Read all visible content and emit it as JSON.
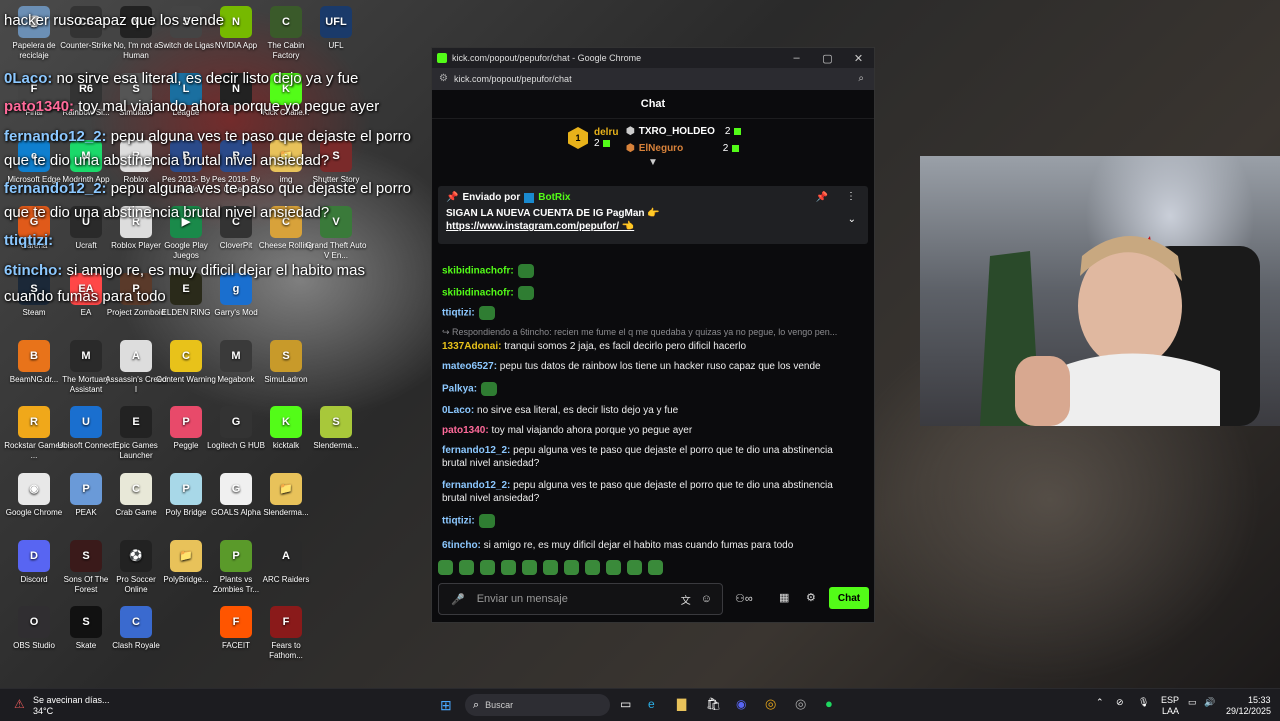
{
  "desktop": {
    "icons": [
      {
        "label": "Papelera de reciclaje",
        "color": "#6b8fb5",
        "glyph": "🗑"
      },
      {
        "label": "Counter-Strike",
        "color": "#333",
        "glyph": "CS"
      },
      {
        "label": "No, I'm not a Human",
        "color": "#222",
        "glyph": "N"
      },
      {
        "label": "Switch de Ligas",
        "color": "#444",
        "glyph": "S"
      },
      {
        "label": "NVIDIA App",
        "color": "#76b900",
        "glyph": "N"
      },
      {
        "label": "The Cabin Factory",
        "color": "#3a5a2a",
        "glyph": "C"
      },
      {
        "label": "UFL",
        "color": "#1a3a6a",
        "glyph": "UFL"
      },
      {
        "label": "Final",
        "color": "#444",
        "glyph": "F"
      },
      {
        "label": "Rainbow Si...",
        "color": "#333",
        "glyph": "R6"
      },
      {
        "label": "Simulator",
        "color": "#555",
        "glyph": "S"
      },
      {
        "label": "League",
        "color": "#1a6fa0",
        "glyph": "L"
      },
      {
        "label": "",
        "color": "#222",
        "glyph": "N"
      },
      {
        "label": "Kick Challe...",
        "color": "#53fc18",
        "glyph": "K"
      },
      {
        "label": "Microsoft Edge",
        "color": "#0f7fcf",
        "glyph": "e"
      },
      {
        "label": "Modrinth App",
        "color": "#1bd96a",
        "glyph": "M"
      },
      {
        "label": "Roblox",
        "color": "#ddd",
        "glyph": "R"
      },
      {
        "label": "Pes 2013- By Cimelo",
        "color": "#2a4a8a",
        "glyph": "P"
      },
      {
        "label": "Pes 2018- By Cimelo",
        "color": "#2a4a8a",
        "glyph": "P"
      },
      {
        "label": "img",
        "color": "#e8c25a",
        "glyph": "📁"
      },
      {
        "label": "Shutter Story",
        "color": "#7a2a2a",
        "glyph": "S"
      },
      {
        "label": "Garena",
        "color": "#e05a1a",
        "glyph": "G"
      },
      {
        "label": "Ucraft",
        "color": "#2a2a2a",
        "glyph": "U"
      },
      {
        "label": "Roblox Player",
        "color": "#ddd",
        "glyph": "R"
      },
      {
        "label": "Google Play Juegos",
        "color": "#1a8a4a",
        "glyph": "▶"
      },
      {
        "label": "CloverPit",
        "color": "#333",
        "glyph": "C"
      },
      {
        "label": "Cheese Rolling",
        "color": "#d8a23a",
        "glyph": "C"
      },
      {
        "label": "Grand Theft Auto V En...",
        "color": "#3a7a3a",
        "glyph": "V"
      },
      {
        "label": "Steam",
        "color": "#1b2838",
        "glyph": "S"
      },
      {
        "label": "EA",
        "color": "#ff4747",
        "glyph": "EA"
      },
      {
        "label": "Project Zomboid",
        "color": "#5a3a2a",
        "glyph": "P"
      },
      {
        "label": "ELDEN RING",
        "color": "#2a2a1a",
        "glyph": "E"
      },
      {
        "label": "Garry's Mod",
        "color": "#1a6fcf",
        "glyph": "g"
      },
      {
        "label": "BeamNG.dr...",
        "color": "#e8731a",
        "glyph": "B"
      },
      {
        "label": "The Mortuary Assistant",
        "color": "#2a2a2a",
        "glyph": "M"
      },
      {
        "label": "Assassin's Creed I",
        "color": "#ddd",
        "glyph": "A"
      },
      {
        "label": "Content Warning",
        "color": "#e8c21a",
        "glyph": "C"
      },
      {
        "label": "Megabonk",
        "color": "#3a3a3a",
        "glyph": "M"
      },
      {
        "label": "SimuLadron",
        "color": "#c89a2a",
        "glyph": "S"
      },
      {
        "label": "Rockstar Games ...",
        "color": "#f0a81a",
        "glyph": "R"
      },
      {
        "label": "Ubisoft Connect",
        "color": "#1a6fcf",
        "glyph": "U"
      },
      {
        "label": "Epic Games Launcher",
        "color": "#222",
        "glyph": "E"
      },
      {
        "label": "Peggle",
        "color": "#e84a6a",
        "glyph": "P"
      },
      {
        "label": "Logitech G HUB",
        "color": "#333",
        "glyph": "G"
      },
      {
        "label": "kicktalk",
        "color": "#53fc18",
        "glyph": "K"
      },
      {
        "label": "Slenderma...",
        "color": "#a8c83a",
        "glyph": "S"
      },
      {
        "label": "Google Chrome",
        "color": "#e8e8e8",
        "glyph": "◉"
      },
      {
        "label": "PEAK",
        "color": "#6a9ad8",
        "glyph": "P"
      },
      {
        "label": "Crab Game",
        "color": "#e8e8d8",
        "glyph": "C"
      },
      {
        "label": "Poly Bridge",
        "color": "#a8d8e8",
        "glyph": "P"
      },
      {
        "label": "GOALS Alpha",
        "color": "#f0f0f0",
        "glyph": "G"
      },
      {
        "label": "Slenderma...",
        "color": "#e8c25a",
        "glyph": "📁"
      },
      {
        "label": "Discord",
        "color": "#5865f2",
        "glyph": "D"
      },
      {
        "label": "Sons Of The Forest",
        "color": "#3a1a1a",
        "glyph": "S"
      },
      {
        "label": "Pro Soccer Online",
        "color": "#222",
        "glyph": "⚽"
      },
      {
        "label": "PolyBridge...",
        "color": "#e8c25a",
        "glyph": "📁"
      },
      {
        "label": "Plants vs Zombies Tr...",
        "color": "#5a9a2a",
        "glyph": "P"
      },
      {
        "label": "ARC Raiders",
        "color": "#2a2a2a",
        "glyph": "A"
      },
      {
        "label": "OBS Studio",
        "color": "#302e31",
        "glyph": "O"
      },
      {
        "label": "Skate",
        "color": "#111",
        "glyph": "S"
      },
      {
        "label": "Clash Royale",
        "color": "#3a6acf",
        "glyph": "C"
      },
      {
        "label": "FACEIT",
        "color": "#ff5500",
        "glyph": "F"
      },
      {
        "label": "Fears to Fathom...",
        "color": "#8a1a1a",
        "glyph": "F"
      }
    ]
  },
  "overlay_chat": [
    {
      "user": "",
      "text": "hacker ruso capaz que los vende",
      "color": "#ffffff"
    },
    {
      "user": "0Laco:",
      "text": " no sirve esa literal, es decir listo dejo ya y fue",
      "color": "#8cc8ff"
    },
    {
      "user": "pato1340:",
      "text": " toy mal viajando ahora porque yo pegue ayer",
      "color": "#ff6a9a"
    },
    {
      "user": "fernando12_2:",
      "text": " pepu alguna ves te paso que dejaste el porro",
      "color": "#8cc8ff"
    },
    {
      "user": "",
      "text": "que te dio una abstinencia brutal nivel ansiedad?",
      "color": "#ffffff"
    },
    {
      "user": "fernando12_2:",
      "text": " pepu alguna ves te paso que dejaste el porro",
      "color": "#8cc8ff"
    },
    {
      "user": "",
      "text": "que te dio una abstinencia brutal nivel ansiedad?",
      "color": "#ffffff"
    },
    {
      "user": "ttiqtizi:",
      "text": "",
      "color": "#8cc8ff"
    },
    {
      "user": "6tincho:",
      "text": " si amigo      re, es muy dificil dejar el habito mas",
      "color": "#8cc8ff"
    },
    {
      "user": "",
      "text": "cuando fumas para todo",
      "color": "#ffffff"
    }
  ],
  "window": {
    "title": "kick.com/popout/pepufor/chat - Google Chrome",
    "url": "kick.com/popout/pepufor/chat",
    "chat_header": "Chat",
    "leaderboard": {
      "first": {
        "name": "delru",
        "count": "2"
      },
      "second": {
        "name": "TXRO_HOLDEO",
        "count": "2"
      },
      "third": {
        "name": "ElNeguro",
        "count": "2"
      }
    },
    "pinned": {
      "prefix": "Enviado por",
      "sender": "BotRix",
      "line1": "SIGAN LA NUEVA CUENTA DE IG PagMan 👉",
      "line2": "https://www.instagram.com/pepufor/ 👈"
    },
    "messages": [
      {
        "user": "skibidinachofr:",
        "text": "",
        "color": "#53fc18",
        "emote": true
      },
      {
        "user": "skibidinachofr:",
        "text": "",
        "color": "#53fc18",
        "emote": true
      },
      {
        "user": "ttiqtizi:",
        "text": "",
        "color": "#8cc8ff",
        "emote": true
      },
      {
        "reply": "Respondiendo a 6tincho: recien me fume el q me quedaba y quizas ya no pegue, lo vengo pen..."
      },
      {
        "user": "1337Adonai:",
        "text": " tranqui somos 2 jaja, es facil decirlo pero dificil hacerlo",
        "color": "#e8c21a"
      },
      {
        "user": "mateo6527:",
        "text": " pepu tus datos de rainbow los tiene un hacker ruso capaz que los vende",
        "color": "#8cc8ff"
      },
      {
        "user": "Palkya:",
        "text": "",
        "color": "#8cc8ff",
        "emote": true
      },
      {
        "user": "0Laco:",
        "text": " no sirve esa literal, es decir listo dejo ya y fue",
        "color": "#8cc8ff"
      },
      {
        "user": "pato1340:",
        "text": " toy mal viajando ahora porque yo pegue ayer",
        "color": "#ff6a9a"
      },
      {
        "user": "fernando12_2:",
        "text": " pepu alguna ves te paso que dejaste el porro que te dio una abstinencia brutal nivel ansiedad?",
        "color": "#8cc8ff"
      },
      {
        "user": "fernando12_2:",
        "text": " pepu alguna ves te paso que dejaste el porro que te dio una abstinencia brutal nivel ansiedad?",
        "color": "#8cc8ff"
      },
      {
        "user": "ttiqtizi:",
        "text": "",
        "color": "#8cc8ff",
        "emote": true
      },
      {
        "user": "6tincho:",
        "text": " si amigo      re, es muy dificil dejar el habito mas cuando fumas para todo",
        "color": "#8cc8ff"
      }
    ],
    "input_placeholder": "Enviar un mensaje",
    "send_label": "Chat"
  },
  "taskbar": {
    "weather_text": "Se avecinan días...",
    "weather_temp": "34°C",
    "search_placeholder": "Buscar",
    "lang": "ESP",
    "lang2": "LAA",
    "time": "15:33",
    "date": "29/12/2025"
  }
}
